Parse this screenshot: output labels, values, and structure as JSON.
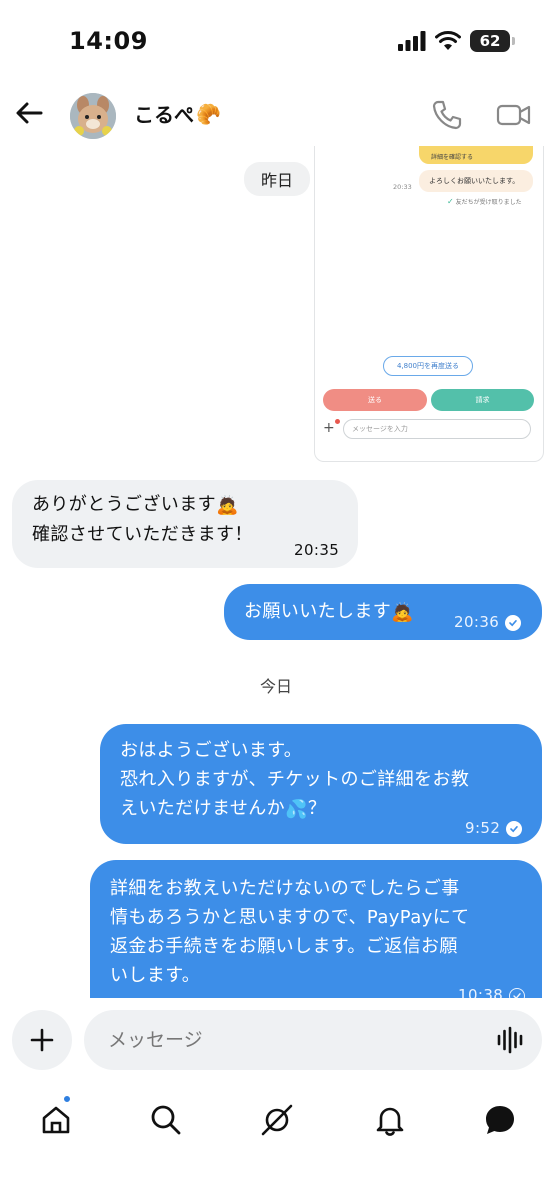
{
  "status_bar": {
    "time": "14:09",
    "battery": "62"
  },
  "header": {
    "contact_name": "こるぺ",
    "contact_emoji": "🥐"
  },
  "embedded_screenshot": {
    "top_banner": "詳細を確認する",
    "bubble": "よろしくお願いいたします。",
    "time": "20:33",
    "read_status": "友だちが受け取りました",
    "resend_button": "4,800円を再度送る",
    "send_button": "送る",
    "request_button": "請求",
    "input_placeholder": "メッセージを入力"
  },
  "date_separators": {
    "yesterday": "昨日",
    "today": "今日"
  },
  "messages": [
    {
      "direction": "in",
      "lines": [
        "ありがとうございます",
        "確認させていただきます！"
      ],
      "emoji": "🙇",
      "time": "20:35"
    },
    {
      "direction": "out",
      "lines": [
        "お願いいたします"
      ],
      "emoji": "🙇",
      "time": "20:36",
      "status": "read"
    },
    {
      "direction": "out",
      "lines": [
        "おはようございます。",
        "恐れ入りますが、チケットのご詳細をお教",
        "えいただけませんか",
        "？"
      ],
      "emoji": "💦",
      "time": "9:52",
      "status": "read"
    },
    {
      "direction": "out",
      "lines": [
        "詳細をお教えいただけないのでしたらご事",
        "情もあろうかと思いますので、PayPayにて",
        "返金お手続きをお願いします。ご返信お願",
        "いします。"
      ],
      "time": "10:38",
      "status": "sent"
    }
  ],
  "composer": {
    "placeholder": "メッセージ"
  },
  "tabs": [
    "home-icon",
    "search-icon",
    "spaces-icon",
    "bell-icon",
    "messages-icon"
  ],
  "colors": {
    "outgoing": "#3d8ee8",
    "incoming": "#eff1f3",
    "accent": "#2f7fe0"
  }
}
